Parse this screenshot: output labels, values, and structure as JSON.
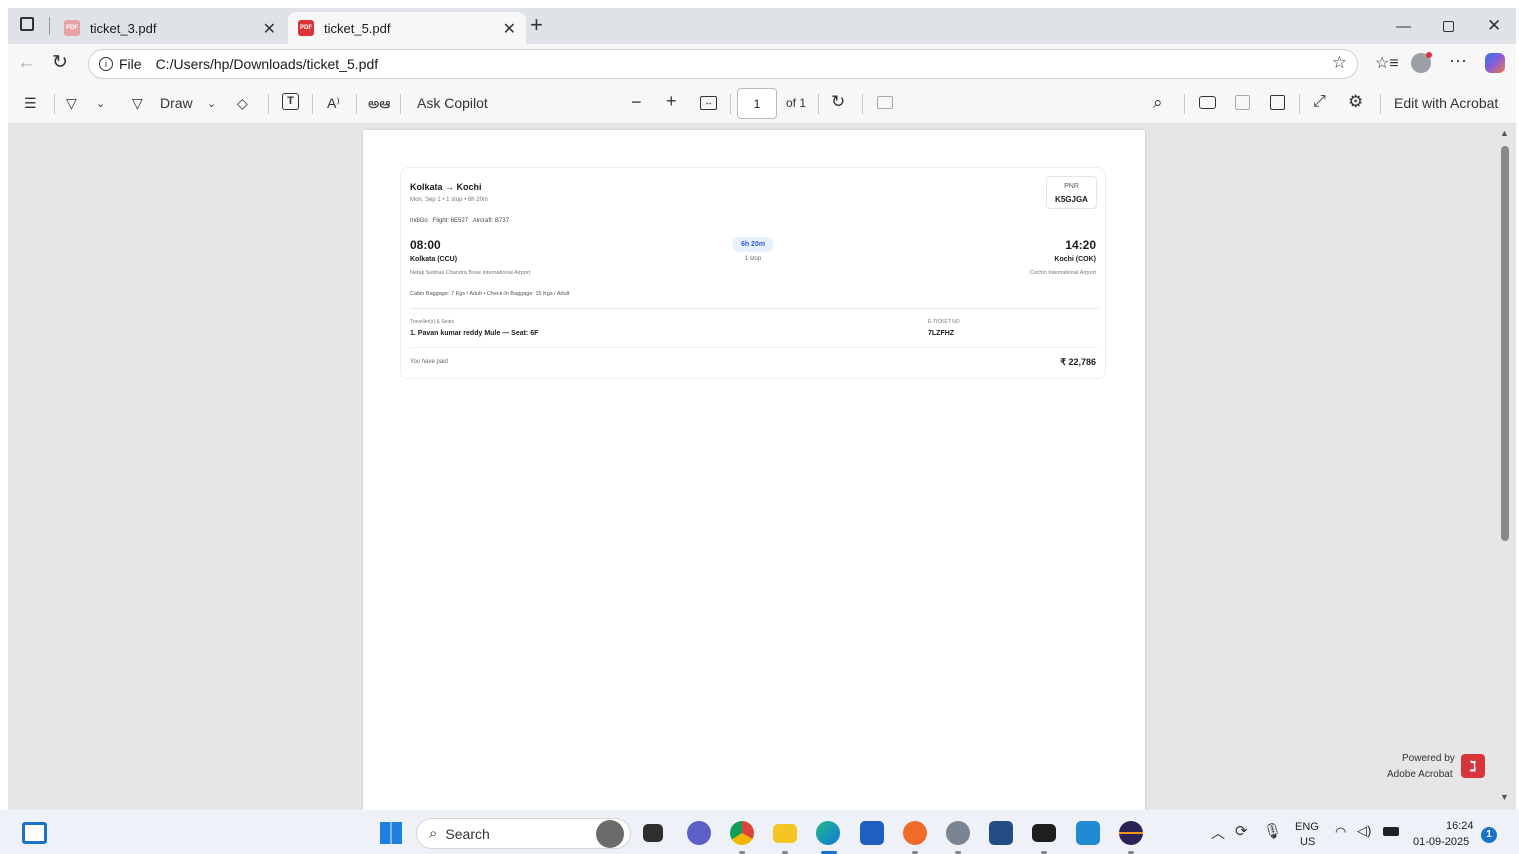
{
  "browser": {
    "tabs": [
      {
        "label": "ticket_3.pdf",
        "active": false
      },
      {
        "label": "ticket_5.pdf",
        "active": true
      }
    ],
    "address": {
      "scheme_label": "File",
      "url": "C:/Users/hp/Downloads/ticket_5.pdf"
    }
  },
  "pdf_toolbar": {
    "draw_label": "Draw",
    "read_aloud_label": "A⁾",
    "translate_label": "అఆ",
    "copilot_label": "Ask Copilot",
    "page_current": "1",
    "page_total_label": "of 1",
    "edit_label": "Edit with Acrobat"
  },
  "ticket": {
    "route": "Kolkata → Kochi",
    "summary": "Mon, Sep 1 • 1 stop • 6h 20m",
    "pnr_label": "PNR",
    "pnr": "K5GJGA",
    "carrier_line": "IndiGo   Flight: 6E527   Aircraft: B737",
    "dep_time": "08:00",
    "dep_city": "Kolkata (CCU)",
    "dep_airport": "Netaji Subhas Chandra Bose International Airport",
    "duration": "6h 20m",
    "stops": "1 stop",
    "arr_time": "14:20",
    "arr_city": "Kochi (COK)",
    "arr_airport": "Cochin International Airport",
    "baggage": "Cabin Baggage: 7 Kgs / Adult • Check-In Baggage: 15 Kgs / Adult",
    "travellers_label": "Traveller(s) & Seats",
    "traveller": "1. Pavan kumar reddy Mule — Seat: 6F",
    "eticket_label": "E-TICKET NO",
    "eticket": "7LZFHZ",
    "paid_label": "You have paid",
    "paid_amount": "₹ 22,786"
  },
  "acrobat_badge": {
    "line1": "Powered by",
    "line2": "Adobe Acrobat"
  },
  "taskbar": {
    "search_placeholder": "Search",
    "lang_top": "ENG",
    "lang_bottom": "US",
    "time": "16:24",
    "date": "01-09-2025",
    "notification_count": "1"
  },
  "colors": {
    "accent_pdf": "#d8343b",
    "duration_pill": "#e8f0fe",
    "duration_text": "#2b5fd9"
  }
}
